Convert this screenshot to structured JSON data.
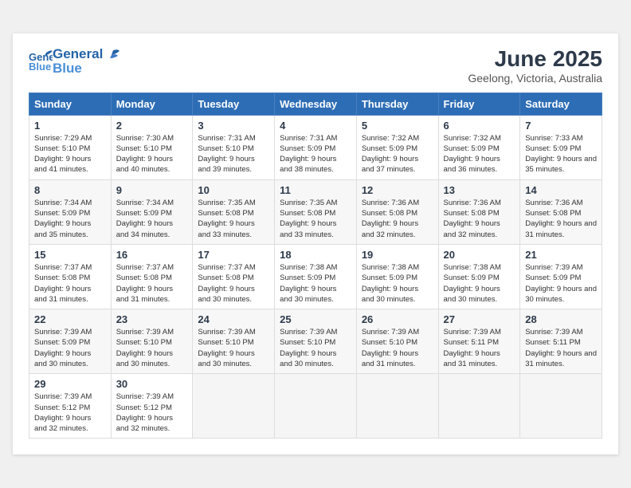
{
  "header": {
    "logo_general": "General",
    "logo_blue": "Blue",
    "month_title": "June 2025",
    "location": "Geelong, Victoria, Australia"
  },
  "weekdays": [
    "Sunday",
    "Monday",
    "Tuesday",
    "Wednesday",
    "Thursday",
    "Friday",
    "Saturday"
  ],
  "weeks": [
    [
      {
        "day": "1",
        "sunrise": "Sunrise: 7:29 AM",
        "sunset": "Sunset: 5:10 PM",
        "daylight": "Daylight: 9 hours and 41 minutes."
      },
      {
        "day": "2",
        "sunrise": "Sunrise: 7:30 AM",
        "sunset": "Sunset: 5:10 PM",
        "daylight": "Daylight: 9 hours and 40 minutes."
      },
      {
        "day": "3",
        "sunrise": "Sunrise: 7:31 AM",
        "sunset": "Sunset: 5:10 PM",
        "daylight": "Daylight: 9 hours and 39 minutes."
      },
      {
        "day": "4",
        "sunrise": "Sunrise: 7:31 AM",
        "sunset": "Sunset: 5:09 PM",
        "daylight": "Daylight: 9 hours and 38 minutes."
      },
      {
        "day": "5",
        "sunrise": "Sunrise: 7:32 AM",
        "sunset": "Sunset: 5:09 PM",
        "daylight": "Daylight: 9 hours and 37 minutes."
      },
      {
        "day": "6",
        "sunrise": "Sunrise: 7:32 AM",
        "sunset": "Sunset: 5:09 PM",
        "daylight": "Daylight: 9 hours and 36 minutes."
      },
      {
        "day": "7",
        "sunrise": "Sunrise: 7:33 AM",
        "sunset": "Sunset: 5:09 PM",
        "daylight": "Daylight: 9 hours and 35 minutes."
      }
    ],
    [
      {
        "day": "8",
        "sunrise": "Sunrise: 7:34 AM",
        "sunset": "Sunset: 5:09 PM",
        "daylight": "Daylight: 9 hours and 35 minutes."
      },
      {
        "day": "9",
        "sunrise": "Sunrise: 7:34 AM",
        "sunset": "Sunset: 5:09 PM",
        "daylight": "Daylight: 9 hours and 34 minutes."
      },
      {
        "day": "10",
        "sunrise": "Sunrise: 7:35 AM",
        "sunset": "Sunset: 5:08 PM",
        "daylight": "Daylight: 9 hours and 33 minutes."
      },
      {
        "day": "11",
        "sunrise": "Sunrise: 7:35 AM",
        "sunset": "Sunset: 5:08 PM",
        "daylight": "Daylight: 9 hours and 33 minutes."
      },
      {
        "day": "12",
        "sunrise": "Sunrise: 7:36 AM",
        "sunset": "Sunset: 5:08 PM",
        "daylight": "Daylight: 9 hours and 32 minutes."
      },
      {
        "day": "13",
        "sunrise": "Sunrise: 7:36 AM",
        "sunset": "Sunset: 5:08 PM",
        "daylight": "Daylight: 9 hours and 32 minutes."
      },
      {
        "day": "14",
        "sunrise": "Sunrise: 7:36 AM",
        "sunset": "Sunset: 5:08 PM",
        "daylight": "Daylight: 9 hours and 31 minutes."
      }
    ],
    [
      {
        "day": "15",
        "sunrise": "Sunrise: 7:37 AM",
        "sunset": "Sunset: 5:08 PM",
        "daylight": "Daylight: 9 hours and 31 minutes."
      },
      {
        "day": "16",
        "sunrise": "Sunrise: 7:37 AM",
        "sunset": "Sunset: 5:08 PM",
        "daylight": "Daylight: 9 hours and 31 minutes."
      },
      {
        "day": "17",
        "sunrise": "Sunrise: 7:37 AM",
        "sunset": "Sunset: 5:08 PM",
        "daylight": "Daylight: 9 hours and 30 minutes."
      },
      {
        "day": "18",
        "sunrise": "Sunrise: 7:38 AM",
        "sunset": "Sunset: 5:09 PM",
        "daylight": "Daylight: 9 hours and 30 minutes."
      },
      {
        "day": "19",
        "sunrise": "Sunrise: 7:38 AM",
        "sunset": "Sunset: 5:09 PM",
        "daylight": "Daylight: 9 hours and 30 minutes."
      },
      {
        "day": "20",
        "sunrise": "Sunrise: 7:38 AM",
        "sunset": "Sunset: 5:09 PM",
        "daylight": "Daylight: 9 hours and 30 minutes."
      },
      {
        "day": "21",
        "sunrise": "Sunrise: 7:39 AM",
        "sunset": "Sunset: 5:09 PM",
        "daylight": "Daylight: 9 hours and 30 minutes."
      }
    ],
    [
      {
        "day": "22",
        "sunrise": "Sunrise: 7:39 AM",
        "sunset": "Sunset: 5:09 PM",
        "daylight": "Daylight: 9 hours and 30 minutes."
      },
      {
        "day": "23",
        "sunrise": "Sunrise: 7:39 AM",
        "sunset": "Sunset: 5:10 PM",
        "daylight": "Daylight: 9 hours and 30 minutes."
      },
      {
        "day": "24",
        "sunrise": "Sunrise: 7:39 AM",
        "sunset": "Sunset: 5:10 PM",
        "daylight": "Daylight: 9 hours and 30 minutes."
      },
      {
        "day": "25",
        "sunrise": "Sunrise: 7:39 AM",
        "sunset": "Sunset: 5:10 PM",
        "daylight": "Daylight: 9 hours and 30 minutes."
      },
      {
        "day": "26",
        "sunrise": "Sunrise: 7:39 AM",
        "sunset": "Sunset: 5:10 PM",
        "daylight": "Daylight: 9 hours and 31 minutes."
      },
      {
        "day": "27",
        "sunrise": "Sunrise: 7:39 AM",
        "sunset": "Sunset: 5:11 PM",
        "daylight": "Daylight: 9 hours and 31 minutes."
      },
      {
        "day": "28",
        "sunrise": "Sunrise: 7:39 AM",
        "sunset": "Sunset: 5:11 PM",
        "daylight": "Daylight: 9 hours and 31 minutes."
      }
    ],
    [
      {
        "day": "29",
        "sunrise": "Sunrise: 7:39 AM",
        "sunset": "Sunset: 5:12 PM",
        "daylight": "Daylight: 9 hours and 32 minutes."
      },
      {
        "day": "30",
        "sunrise": "Sunrise: 7:39 AM",
        "sunset": "Sunset: 5:12 PM",
        "daylight": "Daylight: 9 hours and 32 minutes."
      },
      null,
      null,
      null,
      null,
      null
    ]
  ]
}
